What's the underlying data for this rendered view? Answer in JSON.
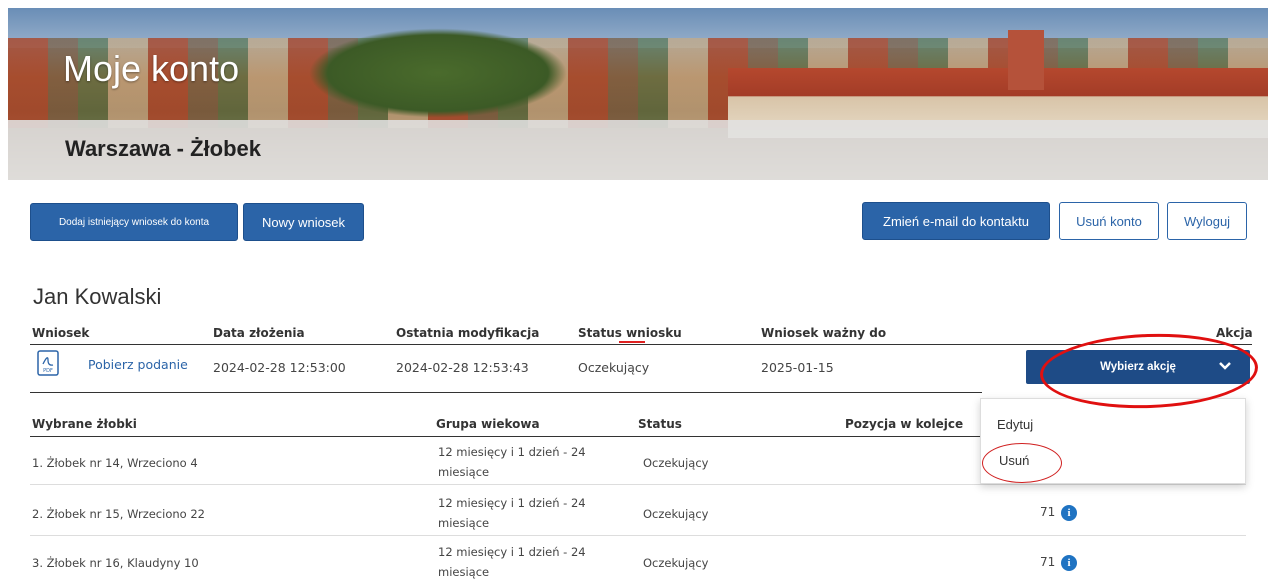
{
  "header": {
    "title": "Moje konto",
    "subtitle": "Warszawa - Żłobek"
  },
  "toolbar": {
    "add_existing_label": "Dodaj istniejący wniosek do konta",
    "new_application_label": "Nowy wniosek",
    "change_email_label": "Zmień e-mail do kontaktu",
    "delete_account_label": "Usuń konto",
    "logout_label": "Wyloguj"
  },
  "user": {
    "name": "Jan Kowalski"
  },
  "application_table": {
    "headers": {
      "application": "Wniosek",
      "submitted": "Data złożenia",
      "modified": "Ostatnia modyfikacja",
      "status": "Status wniosku",
      "valid_until": "Wniosek ważny do",
      "action": "Akcja"
    },
    "row": {
      "link": "Pobierz podanie",
      "submitted": "2024-02-28 12:53:00",
      "modified": "2024-02-28 12:53:43",
      "status": "Oczekujący",
      "valid_until": "2025-01-15",
      "action_select": "Wybierz akcję"
    }
  },
  "action_menu": {
    "items": [
      "Edytuj",
      "Usuń"
    ]
  },
  "nurseries_table": {
    "headers": {
      "nursery": "Wybrane żłobki",
      "age_group": "Grupa wiekowa",
      "status": "Status",
      "position": "Pozycja w kolejce"
    },
    "rows": [
      {
        "nursery": "1. Żłobek nr 14, Wrzeciono 4",
        "age_line1": "12 miesięcy i 1 dzień - 24",
        "age_line2": "miesiące",
        "status": "Oczekujący",
        "position": ""
      },
      {
        "nursery": "2. Żłobek nr 15, Wrzeciono 22",
        "age_line1": "12 miesięcy i 1 dzień - 24",
        "age_line2": "miesiące",
        "status": "Oczekujący",
        "position": "71"
      },
      {
        "nursery": "3. Żłobek nr 16, Klaudyny 10",
        "age_line1": "12 miesięcy i 1 dzień - 24",
        "age_line2": "miesiące",
        "status": "Oczekujący",
        "position": "71"
      }
    ]
  },
  "icons": {
    "pdf": "pdf-file-icon",
    "info": "info-icon",
    "chevron": "chevron-down-icon"
  },
  "colors": {
    "primary": "#2b64a8",
    "select": "#1e4b86",
    "annotation": "#e01010"
  }
}
